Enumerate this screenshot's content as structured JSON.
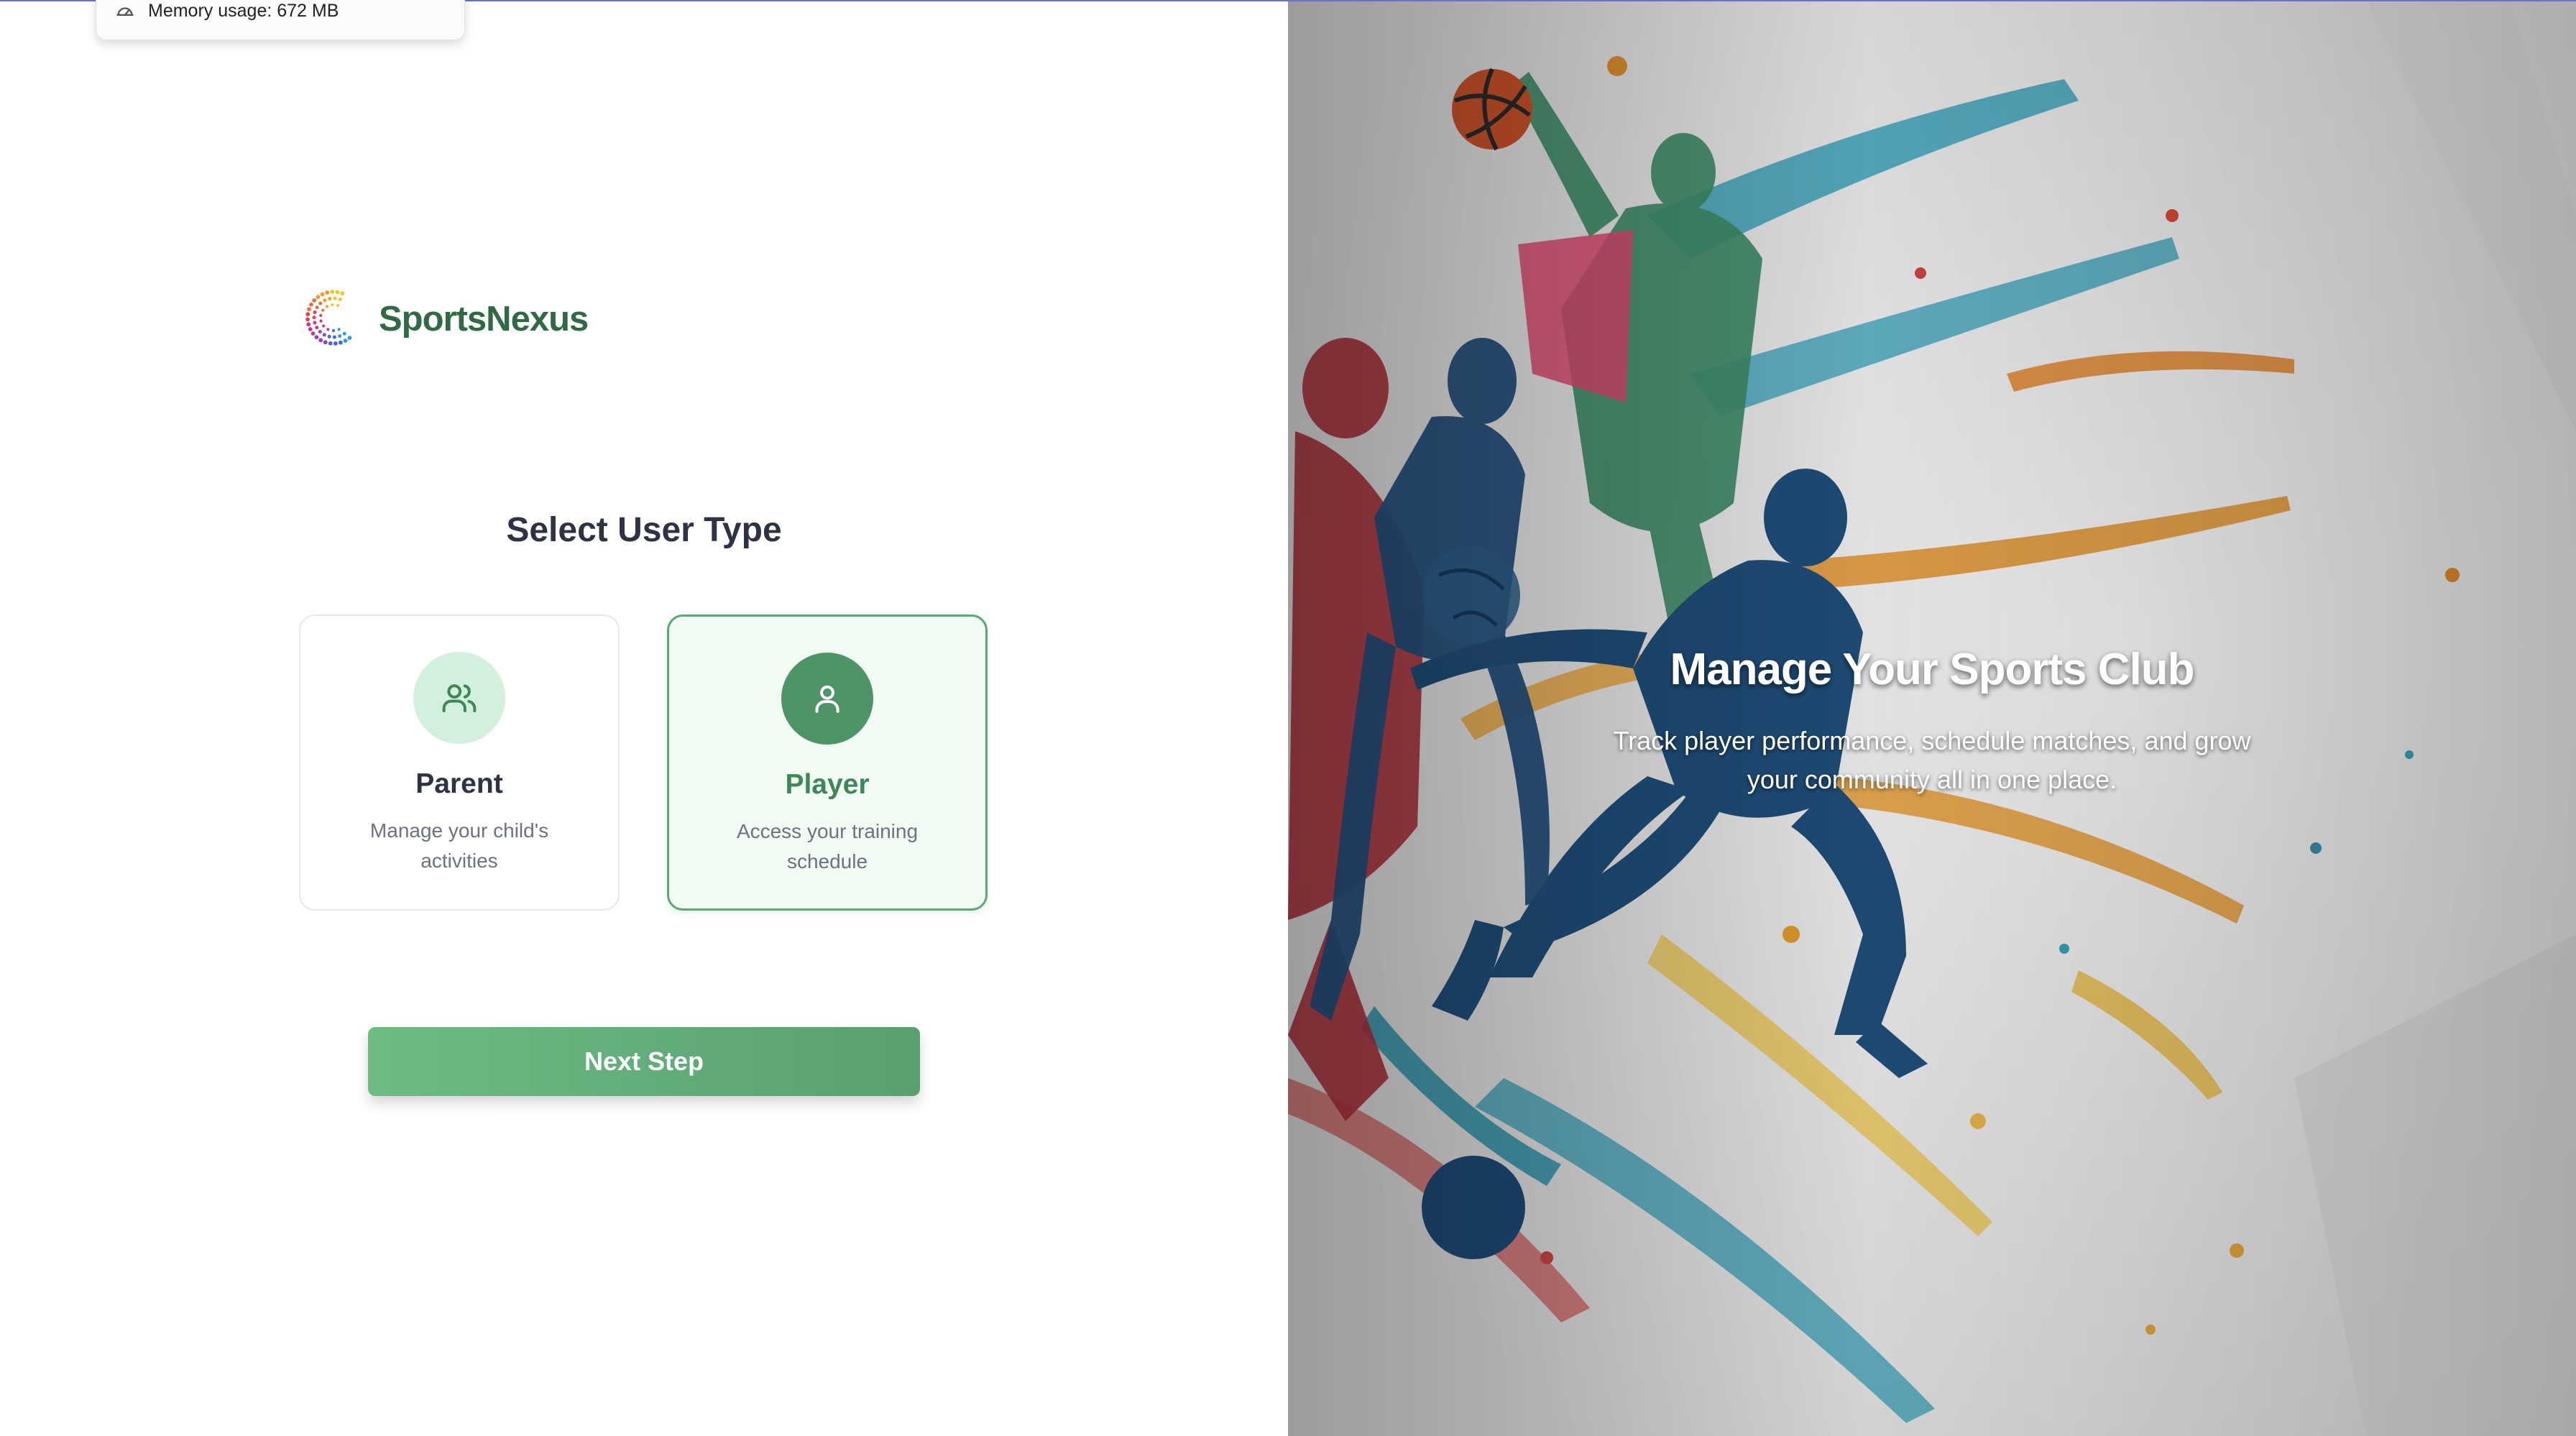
{
  "memory": {
    "text": "Memory usage: 672 MB",
    "icon": "gauge-icon"
  },
  "brand": {
    "name": "SportsNexus",
    "logo_icon": "dotted-ring-logo",
    "color": "#2f6a44"
  },
  "selection": {
    "title": "Select User Type",
    "selected": "Player",
    "cards": [
      {
        "label": "Parent",
        "description": "Manage your child's activities",
        "icon": "users-icon"
      },
      {
        "label": "Player",
        "description": "Access your training schedule",
        "icon": "user-icon"
      }
    ]
  },
  "actions": {
    "next_label": "Next Step"
  },
  "hero": {
    "title": "Manage Your Sports Club",
    "subtitle": "Track player performance, schedule matches, and grow your community all in one place."
  },
  "colors": {
    "accent": "#5aa874",
    "accent_dark": "#4e9467",
    "accent_light": "#d2f0dc",
    "heading": "#2d3344",
    "muted": "#6c7280"
  }
}
